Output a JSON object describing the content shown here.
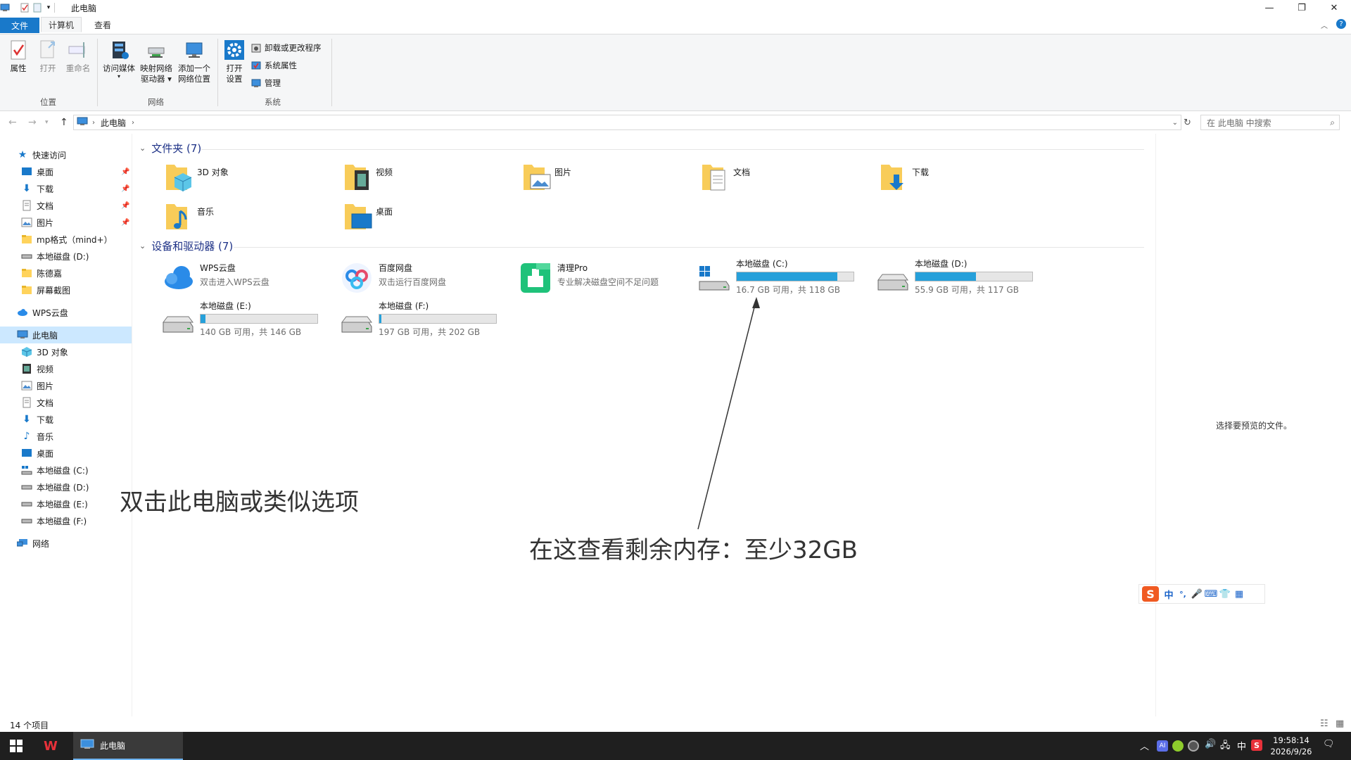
{
  "window": {
    "title": "此电脑"
  },
  "tabs": {
    "file": "文件",
    "computer": "计算机",
    "view": "查看"
  },
  "ribbon": {
    "properties": "属性",
    "open": "打开",
    "rename": "重命名",
    "access_media": "访问媒体",
    "map_drive_1": "映射网络",
    "map_drive_2": "驱动器",
    "add_location_1": "添加一个",
    "add_location_2": "网络位置",
    "open_settings_1": "打开",
    "open_settings_2": "设置",
    "uninstall": "卸载或更改程序",
    "system_props": "系统属性",
    "manage": "管理",
    "group_location": "位置",
    "group_network": "网络",
    "group_system": "系统"
  },
  "address": {
    "path": "此电脑",
    "search_placeholder": "在 此电脑 中搜索"
  },
  "nav": {
    "quick_access": "快速访问",
    "items_quick": [
      "桌面",
      "下载",
      "文档",
      "图片",
      "mp格式（mind+）",
      "本地磁盘 (D:)",
      "陈德嘉",
      "屏幕截图"
    ],
    "wps": "WPS云盘",
    "this_pc": "此电脑",
    "items_pc": [
      "3D 对象",
      "视频",
      "图片",
      "文档",
      "下载",
      "音乐",
      "桌面",
      "本地磁盘 (C:)",
      "本地磁盘 (D:)",
      "本地磁盘 (E:)",
      "本地磁盘 (F:)"
    ],
    "network": "网络"
  },
  "content": {
    "folders_header": "文件夹 (7)",
    "folders": [
      "3D 对象",
      "视频",
      "图片",
      "文档",
      "下载",
      "音乐",
      "桌面"
    ],
    "devices_header": "设备和驱动器 (7)",
    "apps": [
      {
        "name": "WPS云盘",
        "sub": "双击进入WPS云盘"
      },
      {
        "name": "百度网盘",
        "sub": "双击运行百度网盘"
      },
      {
        "name": "清理Pro",
        "sub": "专业解决磁盘空间不足问题"
      }
    ],
    "drives": [
      {
        "name": "本地磁盘 (C:)",
        "info": "16.7 GB 可用，共 118 GB",
        "used_fraction": 0.86
      },
      {
        "name": "本地磁盘 (D:)",
        "info": "55.9 GB 可用，共 117 GB",
        "used_fraction": 0.52
      },
      {
        "name": "本地磁盘 (E:)",
        "info": "140 GB 可用，共 146 GB",
        "used_fraction": 0.04
      },
      {
        "name": "本地磁盘 (F:)",
        "info": "197 GB 可用，共 202 GB",
        "used_fraction": 0.02
      }
    ]
  },
  "preview": {
    "text": "选择要预览的文件。"
  },
  "status": {
    "count": "14 个项目"
  },
  "annotations": {
    "left": "双击此电脑或类似选项",
    "right": "在这查看剩余内存：至少32GB"
  },
  "ime": {
    "lang": "中",
    "punct": "°,"
  },
  "taskbar": {
    "window_label": "此电脑",
    "time": "19:58:14",
    "date": "2026/9/26",
    "ime_lang": "中"
  },
  "colors": {
    "accent": "#1979ca",
    "bar_fill": "#26a0da",
    "selection": "#cce8ff",
    "header_blue": "#1e3287"
  }
}
